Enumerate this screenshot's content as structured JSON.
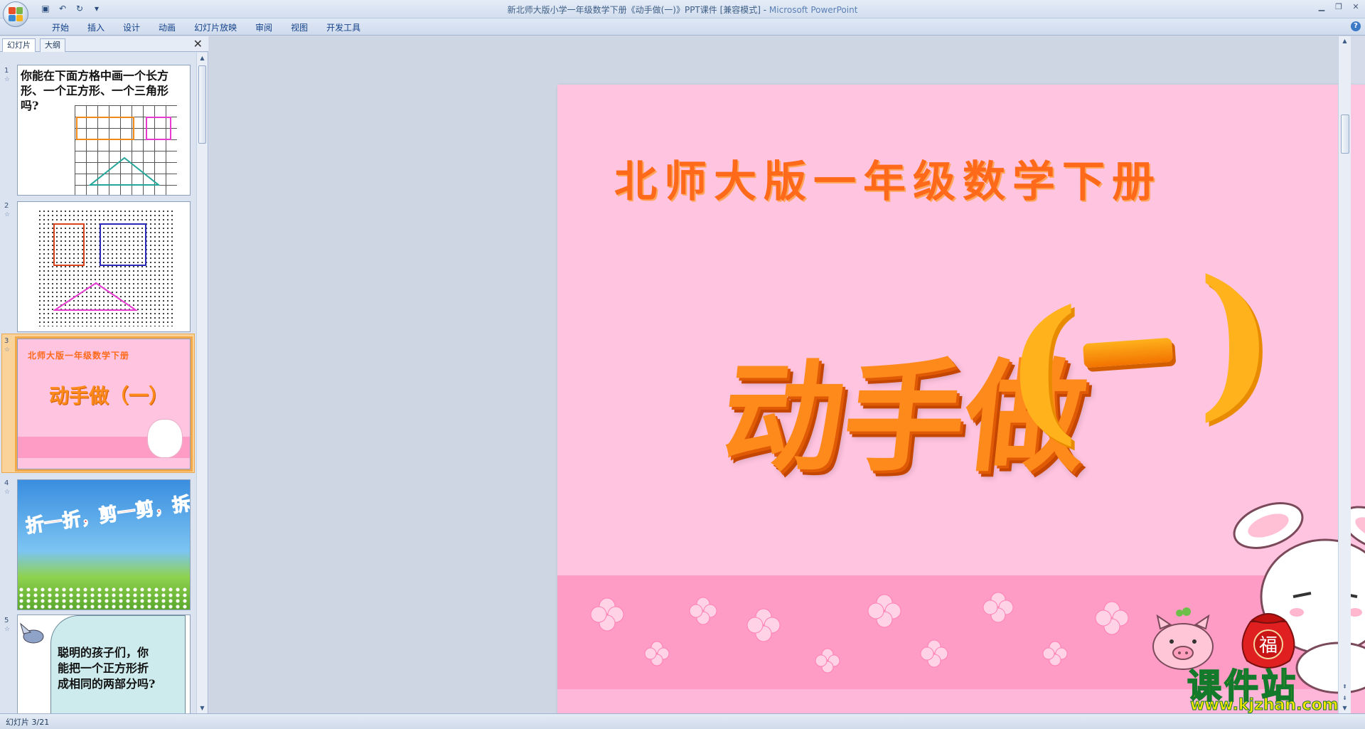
{
  "window": {
    "title": "新北师大版小学一年级数学下册《动手做(一)》PPT课件 [兼容模式] - ",
    "app_name": "Microsoft PowerPoint"
  },
  "ribbon": {
    "tabs": [
      "开始",
      "插入",
      "设计",
      "动画",
      "幻灯片放映",
      "审阅",
      "视图",
      "开发工具"
    ]
  },
  "panel": {
    "tab_slides": "幻灯片",
    "tab_outline": "大纲",
    "close": "✕"
  },
  "thumbnails": [
    {
      "num": "1",
      "text": "你能在下面方格中画一个长方形、一个正方形、一个三角形吗?"
    },
    {
      "num": "2"
    },
    {
      "num": "3",
      "title": "北师大版一年级数学下册",
      "main": "动手做（一）"
    },
    {
      "num": "4",
      "text": "折一折，剪一剪，拆一拆"
    },
    {
      "num": "5",
      "text": "聪明的孩子们，你能把一个正方形折成相同的两部分吗?"
    }
  ],
  "slide": {
    "title": "北师大版一年级数学下册",
    "main_text": "动手做",
    "paren_open": "(",
    "paren_close": ")",
    "bag_char": "福"
  },
  "status": {
    "slide_counter": "幻灯片 3/21"
  },
  "watermark": {
    "brand": "课件站",
    "url": "www.kjzhan.com"
  },
  "colors": {
    "slide_bg": "#ffc4e0",
    "title_orange": "#ff6a1a",
    "band_pink": "#ff9cc6",
    "selected_thumb": "#f3a849"
  }
}
